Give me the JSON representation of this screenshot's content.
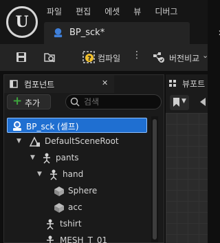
{
  "menu": {
    "items": [
      "파일",
      "편집",
      "에셋",
      "뷰",
      "디버그"
    ]
  },
  "document_tab": {
    "title": "BP_sck*",
    "close_glyph": "✕",
    "icon": "blueprint-icon"
  },
  "toolbar": {
    "save_icon": "save-icon",
    "browse_icon": "browse-icon",
    "compile_label": "컴파일",
    "more_glyph": "⋮",
    "diff_label": "버전비교",
    "diff_icon": "diff-icon",
    "chevron_glyph": "⌄"
  },
  "components_panel": {
    "title": "컴포넌트",
    "close_glyph": "✕",
    "add_label": "추가",
    "search_placeholder": "검색",
    "tree": [
      {
        "label": "BP_sck (셀프)",
        "icon": "blueprint-icon",
        "selected": true
      },
      {
        "label": "DefaultSceneRoot",
        "icon": "scene-root-icon",
        "expanded": true
      },
      {
        "label": "pants",
        "icon": "skeleton-icon",
        "expanded": true
      },
      {
        "label": "hand",
        "icon": "skeleton-icon",
        "expanded": true
      },
      {
        "label": "Sphere",
        "icon": "cube-icon"
      },
      {
        "label": "acc",
        "icon": "cube-icon"
      },
      {
        "label": "tshirt",
        "icon": "skeleton-icon"
      },
      {
        "label": "MESH_T_01",
        "icon": "skeleton-icon"
      }
    ]
  },
  "viewport_panel": {
    "title": "뷰포트",
    "icon": "viewport-icon"
  },
  "colors": {
    "selection": "#1f6fd1",
    "add_plus": "#3ea63e",
    "compile_warning": "#f2c12e"
  }
}
